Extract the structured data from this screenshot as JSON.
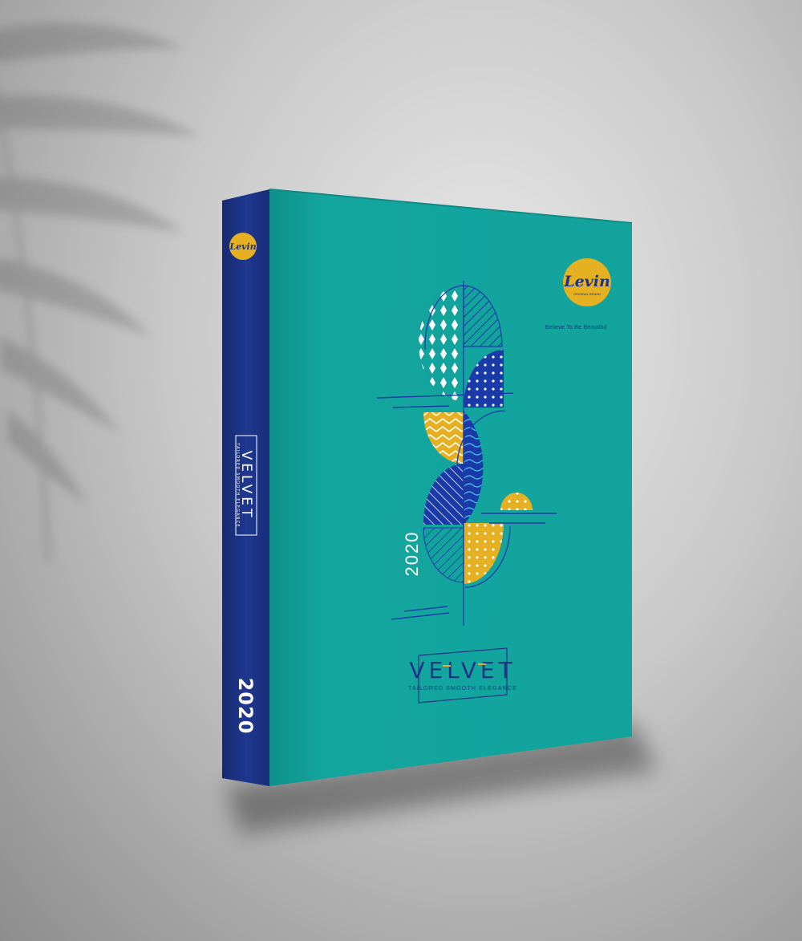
{
  "book": {
    "brand": {
      "logo_text": "Levin",
      "logo_subtext": "ORIGINAL BRAND",
      "tagline": "Believe To Be Beautiful"
    },
    "title": "VELVET",
    "subtitle": "TAILORED SMOOTH ELEGANCE",
    "year": "2020",
    "spine": {
      "year": "2020",
      "title": "VELVET",
      "subtitle": "TAILORED SMOOTH ELEGANCE",
      "logo_text": "Levin"
    }
  },
  "colors": {
    "cover_teal": "#12a39c",
    "spine_navy": "#1d3485",
    "accent_yellow": "#e5b021",
    "pattern_blue": "#1a3aa8",
    "background_gray": "#c9c9c9"
  }
}
